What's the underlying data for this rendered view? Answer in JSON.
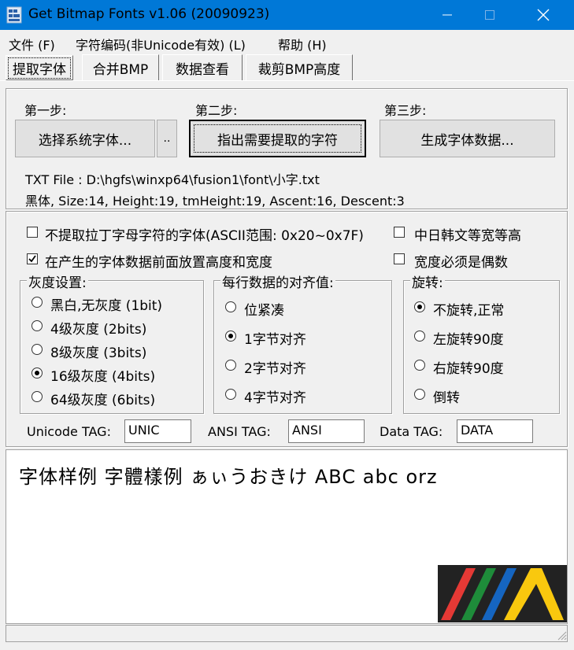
{
  "window": {
    "title": "Get Bitmap Fonts v1.06  (20090923)"
  },
  "menu": [
    "文件 (F)",
    "字符编码(非Unicode有效) (L)",
    "帮助 (H)"
  ],
  "tabs": [
    "提取字体",
    "合并BMP",
    "数据查看",
    "裁剪BMP高度"
  ],
  "steps": {
    "step1": "第一步:",
    "step2": "第二步:",
    "step3": "第三步:",
    "select_font": "选择系统字体...",
    "dots": "..",
    "mark_chars": "指出需要提取的字符",
    "generate": "生成字体数据..."
  },
  "info": {
    "file_line": "TXT File : D:\\hgfs\\winxp64\\fusion1\\font\\小字.txt",
    "font_line": "黑体, Size:14, Height:19, tmHeight:19, Ascent:16, Descent:3"
  },
  "options": {
    "no_latin": "不提取拉丁字母字符的字体(ASCII范围: 0x20~0x7F)",
    "put_size": "在产生的字体数据前面放置高度和宽度",
    "cjk_monowidth": "中日韩文等宽等高",
    "width_even": "宽度必须是偶数"
  },
  "groups": {
    "grayscale": {
      "title": "灰度设置:",
      "items": [
        "黑白,无灰度 (1bit)",
        "4级灰度 (2bits)",
        "8级灰度 (3bits)",
        "16级灰度 (4bits)",
        "64级灰度 (6bits)"
      ]
    },
    "align": {
      "title": "每行数据的对齐值:",
      "items": [
        "位紧凑",
        "1字节对齐",
        "2字节对齐",
        "4字节对齐"
      ]
    },
    "rotate": {
      "title": "旋转:",
      "items": [
        "不旋转,正常",
        "左旋转90度",
        "右旋转90度",
        "倒转"
      ]
    }
  },
  "tags": {
    "unicode_label": "Unicode TAG:",
    "unicode_value": "UNIC",
    "ansi_label": "ANSI TAG:",
    "ansi_value": "ANSI",
    "data_label": "Data TAG:",
    "data_value": "DATA"
  },
  "preview": {
    "sample": "字体样例 字體樣例 ぁぃうおきけ ABC abc orz"
  },
  "state": {
    "no_latin_checked": false,
    "put_size_checked": true,
    "cjk_monowidth_checked": false,
    "width_even_checked": false,
    "grayscale_selected": "16级灰度 (4bits)",
    "align_selected": "1字节对齐",
    "rotate_selected": "不旋转,正常"
  },
  "colors": {
    "titlebar": "#0078d7",
    "window_bg": "#f0f0f0",
    "logo_red": "#e53935",
    "logo_green": "#1e8c3a",
    "logo_blue": "#1565c0",
    "logo_yellow": "#f9c80e"
  }
}
